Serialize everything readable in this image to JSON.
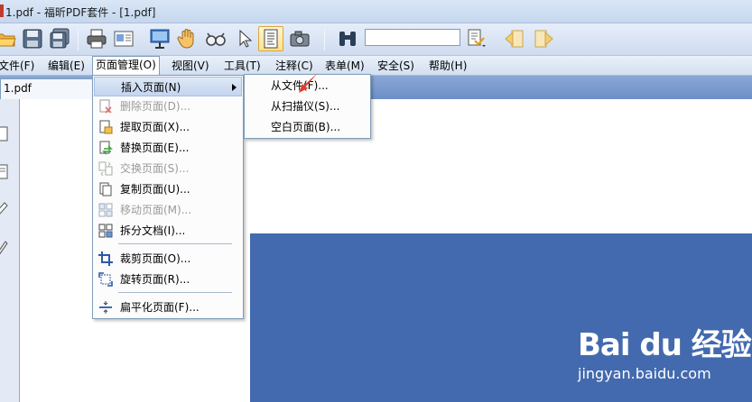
{
  "window": {
    "title": "1.pdf - 福昕PDF套件 - [1.pdf]"
  },
  "toolbar": {
    "buttons": [
      "open-folder-icon",
      "save-icon",
      "save-all-icon",
      "print-icon",
      "page-setup-icon",
      "presentation-icon",
      "hand-tool-icon",
      "zoom-glasses-icon",
      "select-arrow-icon",
      "text-select-icon",
      "snapshot-camera-icon",
      "binoculars-icon",
      "find-options-icon",
      "previous-icon",
      "next-icon"
    ],
    "search_placeholder": ""
  },
  "menubar": {
    "items": [
      "文件(F)",
      "编辑(E)",
      "页面管理(O)",
      "视图(V)",
      "工具(T)",
      "注释(C)",
      "表单(M)",
      "安全(S)",
      "帮助(H)"
    ]
  },
  "document_tab": {
    "label": "1.pdf"
  },
  "page_menu": {
    "items": [
      {
        "label": "插入页面(N)...",
        "icon": "insert-page-icon",
        "enabled": true
      },
      {
        "label": "删除页面(D)...",
        "icon": "delete-page-icon",
        "enabled": false
      },
      {
        "label": "提取页面(X)...",
        "icon": "extract-page-icon",
        "enabled": true
      },
      {
        "label": "替换页面(E)...",
        "icon": "replace-page-icon",
        "enabled": true
      },
      {
        "label": "交换页面(S)...",
        "icon": "swap-page-icon",
        "enabled": false
      },
      {
        "label": "复制页面(U)...",
        "icon": "copy-page-icon",
        "enabled": true
      },
      {
        "label": "移动页面(M)...",
        "icon": "move-page-icon",
        "enabled": false
      },
      {
        "label": "拆分文档(I)...",
        "icon": "split-document-icon",
        "enabled": true
      },
      {
        "label": "裁剪页面(O)...",
        "icon": "crop-page-icon",
        "enabled": true
      },
      {
        "label": "旋转页面(R)...",
        "icon": "rotate-page-icon",
        "enabled": true
      },
      {
        "label": "扁平化页面(F)...",
        "icon": "flatten-page-icon",
        "enabled": true
      }
    ],
    "insert_label": "插入页面(N)"
  },
  "insert_submenu": {
    "items": [
      "从文件(F)...",
      "从扫描仪(S)...",
      "空白页面(B)..."
    ]
  },
  "watermark": {
    "logo": "Bai du 经验",
    "url": "jingyan.baidu.com"
  },
  "colors": {
    "canvas_blue": "#436aae",
    "menu_highlight": "#c3d5ef",
    "annotation_arrow": "#e23b2e"
  }
}
